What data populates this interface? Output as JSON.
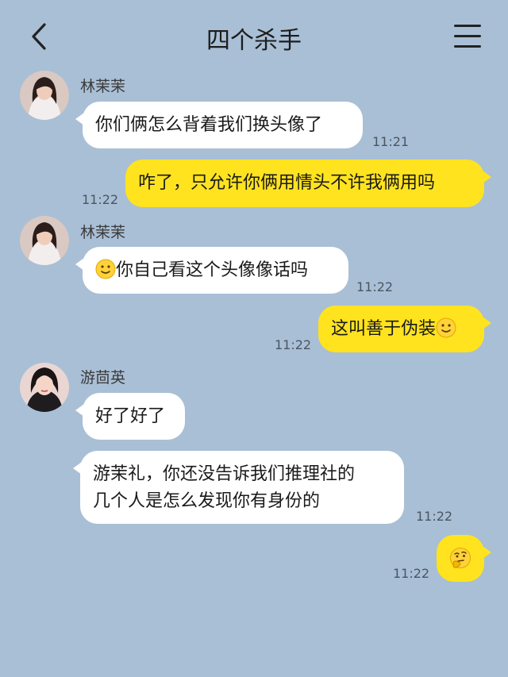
{
  "header": {
    "title": "四个杀手",
    "back_icon": "chevron-left-icon",
    "menu_icon": "hamburger-menu-icon"
  },
  "colors": {
    "background": "#a9bfd5",
    "incoming_bubble": "#ffffff",
    "outgoing_bubble": "#ffe31e"
  },
  "messages": [
    {
      "sender": "林茉茉",
      "text": "你们俩怎么背着我们换头像了",
      "time": "11:21"
    },
    {
      "sender": "me",
      "text": "咋了，只允许你俩用情头不许我俩用吗",
      "time": "11:22"
    },
    {
      "sender": "林茉茉",
      "emoji": "slightly-smiling-face",
      "text": "你自己看这个头像像话吗",
      "time": "11:22"
    },
    {
      "sender": "me",
      "text": "这叫善于伪装",
      "emoji": "slightly-smiling-face",
      "time": "11:22"
    },
    {
      "sender": "游茴英",
      "text": "好了好了"
    },
    {
      "sender": "游茴英",
      "lines": [
        "游茉礼，你还没告诉我们推理社的",
        "几个人是怎么发现你有身份的"
      ],
      "time": "11:22"
    },
    {
      "sender": "me",
      "emoji": "thinking-face",
      "time": "11:22"
    }
  ]
}
